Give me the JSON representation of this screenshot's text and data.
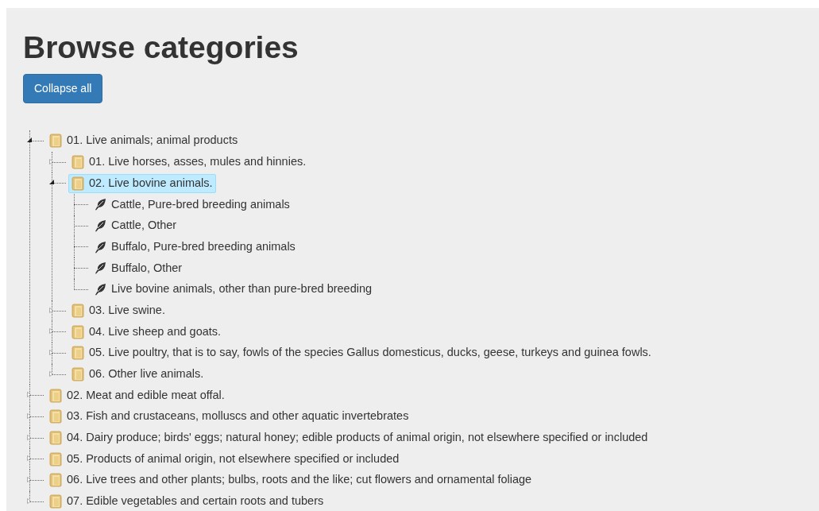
{
  "title": "Browse categories",
  "button": {
    "label": "Collapse all"
  },
  "tree": [
    {
      "label": "01. Live animals; animal products",
      "kind": "folder",
      "expanded": true,
      "selected": false,
      "children": [
        {
          "label": "01. Live horses, asses, mules and hinnies.",
          "kind": "folder",
          "expanded": false,
          "selected": false
        },
        {
          "label": "02. Live bovine animals.",
          "kind": "folder",
          "expanded": true,
          "selected": true,
          "children": [
            {
              "label": "Cattle, Pure-bred breeding animals",
              "kind": "leaf",
              "selected": false
            },
            {
              "label": "Cattle, Other",
              "kind": "leaf",
              "selected": false
            },
            {
              "label": "Buffalo, Pure-bred breeding animals",
              "kind": "leaf",
              "selected": false
            },
            {
              "label": "Buffalo, Other",
              "kind": "leaf",
              "selected": false
            },
            {
              "label": "Live bovine animals, other than pure-bred breeding",
              "kind": "leaf",
              "selected": false
            }
          ]
        },
        {
          "label": "03. Live swine.",
          "kind": "folder",
          "expanded": false,
          "selected": false
        },
        {
          "label": "04. Live sheep and goats.",
          "kind": "folder",
          "expanded": false,
          "selected": false
        },
        {
          "label": "05. Live poultry, that is to say, fowls of the species Gallus domesticus, ducks, geese, turkeys and guinea fowls.",
          "kind": "folder",
          "expanded": false,
          "selected": false
        },
        {
          "label": "06. Other live animals.",
          "kind": "folder",
          "expanded": false,
          "selected": false
        }
      ]
    },
    {
      "label": "02. Meat and edible meat offal.",
      "kind": "folder",
      "expanded": false,
      "selected": false
    },
    {
      "label": "03. Fish and crustaceans, molluscs and other aquatic invertebrates",
      "kind": "folder",
      "expanded": false,
      "selected": false
    },
    {
      "label": "04. Dairy produce; birds' eggs; natural honey; edible products of animal origin, not elsewhere specified or included",
      "kind": "folder",
      "expanded": false,
      "selected": false
    },
    {
      "label": "05. Products of animal origin, not elsewhere specified or included",
      "kind": "folder",
      "expanded": false,
      "selected": false
    },
    {
      "label": "06. Live trees and other plants; bulbs, roots and the like; cut flowers and ornamental foliage",
      "kind": "folder",
      "expanded": false,
      "selected": false
    },
    {
      "label": "07. Edible vegetables and certain roots and tubers",
      "kind": "folder",
      "expanded": false,
      "selected": false
    }
  ]
}
